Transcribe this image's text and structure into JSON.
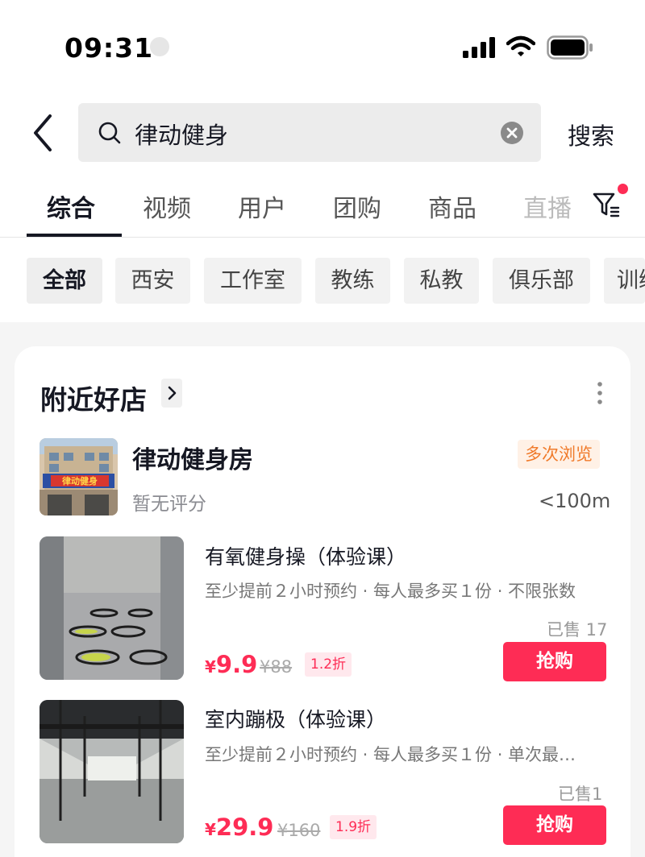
{
  "status_bar": {
    "time": "09:31"
  },
  "search": {
    "query": "律动健身",
    "submit_label": "搜索"
  },
  "tabs": [
    {
      "label": "综合"
    },
    {
      "label": "视频"
    },
    {
      "label": "用户"
    },
    {
      "label": "团购"
    },
    {
      "label": "商品"
    },
    {
      "label": "直播"
    }
  ],
  "chips": [
    {
      "label": "全部"
    },
    {
      "label": "西安"
    },
    {
      "label": "工作室"
    },
    {
      "label": "教练"
    },
    {
      "label": "私教"
    },
    {
      "label": "俱乐部"
    },
    {
      "label": "训练"
    }
  ],
  "nearby": {
    "title": "附近好店",
    "shop": {
      "name": "律动健身房",
      "sign_text": "律动健身",
      "rating": "暂无评分",
      "badge": "多次浏览",
      "distance": "<100m"
    },
    "deals": [
      {
        "title": "有氧健身操（体验课）",
        "desc": "至少提前２小时预约 · 每人最多买１份 · 不限张数",
        "sold": "已售 17",
        "yen": "¥",
        "price": "9.9",
        "original": "¥88",
        "discount": "1.2折",
        "buy_label": "抢购"
      },
      {
        "title": "室内蹦极（体验课）",
        "desc": "至少提前２小时预约 · 每人最多买１份 · 单次最…",
        "sold": "已售1",
        "yen": "¥",
        "price": "29.9",
        "original": "¥160",
        "discount": "1.9折",
        "buy_label": "抢购"
      }
    ]
  },
  "colors": {
    "accent": "#fe2c55",
    "badge_orange": "#f07a2a",
    "text": "#161823"
  }
}
